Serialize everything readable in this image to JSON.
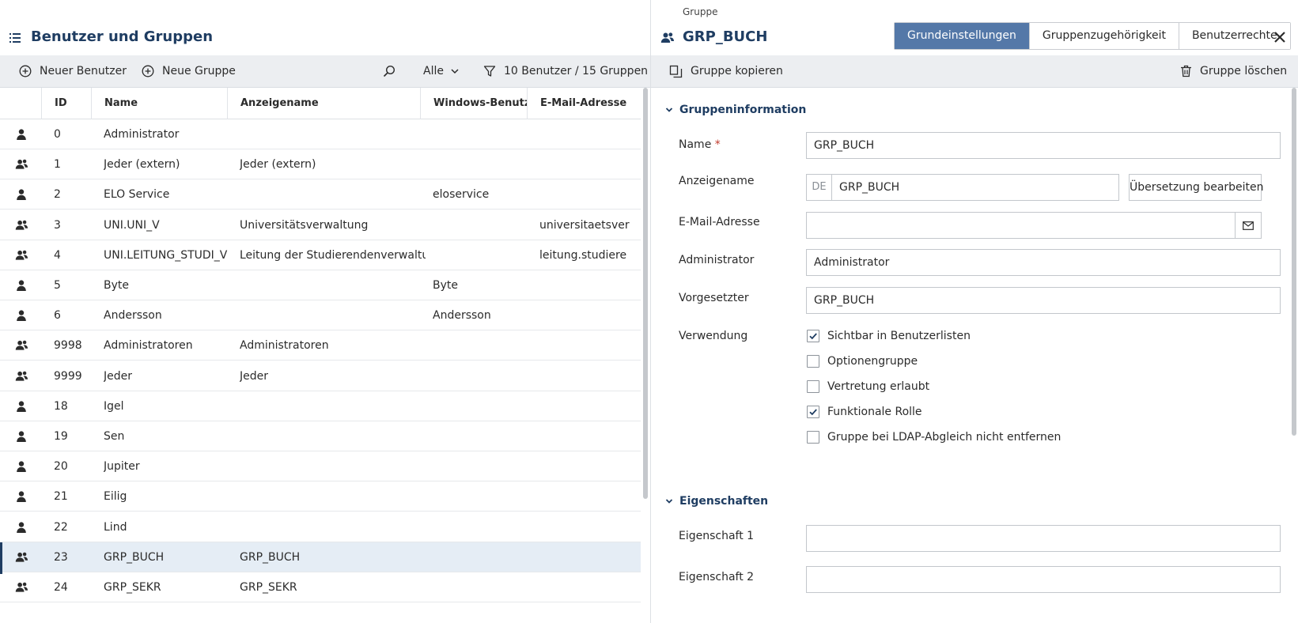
{
  "left": {
    "title": "Benutzer und Gruppen",
    "toolbar": {
      "new_user": "Neuer Benutzer",
      "new_group": "Neue Gruppe",
      "filter_value": "Alle",
      "count": "10 Benutzer / 15 Gruppen"
    },
    "columns": [
      "ID",
      "Name",
      "Anzeigename",
      "Windows-Benutzer",
      "E-Mail-Adresse"
    ],
    "rows": [
      {
        "type": "user",
        "id": "0",
        "name": "Administrator",
        "display": "",
        "windows": "",
        "email": ""
      },
      {
        "type": "group",
        "id": "1",
        "name": "Jeder (extern)",
        "display": "Jeder (extern)",
        "windows": "",
        "email": ""
      },
      {
        "type": "user",
        "id": "2",
        "name": "ELO Service",
        "display": "",
        "windows": "eloservice",
        "email": ""
      },
      {
        "type": "group",
        "id": "3",
        "name": "UNI.UNI_V",
        "display": "Universitätsverwaltung",
        "windows": "",
        "email": "universitaetsver"
      },
      {
        "type": "group",
        "id": "4",
        "name": "UNI.LEITUNG_STUDI_V",
        "display": "Leitung der Studierendenverwaltung",
        "windows": "",
        "email": "leitung.studiere"
      },
      {
        "type": "user",
        "id": "5",
        "name": "Byte",
        "display": "",
        "windows": "Byte",
        "email": ""
      },
      {
        "type": "user",
        "id": "6",
        "name": "Andersson",
        "display": "",
        "windows": "Andersson",
        "email": ""
      },
      {
        "type": "group",
        "id": "9998",
        "name": "Administratoren",
        "display": "Administratoren",
        "windows": "",
        "email": ""
      },
      {
        "type": "group",
        "id": "9999",
        "name": "Jeder",
        "display": "Jeder",
        "windows": "",
        "email": ""
      },
      {
        "type": "user",
        "id": "18",
        "name": "Igel",
        "display": "",
        "windows": "",
        "email": ""
      },
      {
        "type": "user",
        "id": "19",
        "name": "Sen",
        "display": "",
        "windows": "",
        "email": ""
      },
      {
        "type": "user",
        "id": "20",
        "name": "Jupiter",
        "display": "",
        "windows": "",
        "email": ""
      },
      {
        "type": "user",
        "id": "21",
        "name": "Eilig",
        "display": "",
        "windows": "",
        "email": ""
      },
      {
        "type": "user",
        "id": "22",
        "name": "Lind",
        "display": "",
        "windows": "",
        "email": ""
      },
      {
        "type": "group",
        "id": "23",
        "name": "GRP_BUCH",
        "display": "GRP_BUCH",
        "windows": "",
        "email": "",
        "selected": true
      },
      {
        "type": "group",
        "id": "24",
        "name": "GRP_SEKR",
        "display": "GRP_SEKR",
        "windows": "",
        "email": ""
      }
    ]
  },
  "right": {
    "kicker": "Gruppe",
    "title": "GRP_BUCH",
    "tabs": [
      {
        "label": "Grundeinstellungen",
        "active": true
      },
      {
        "label": "Gruppenzugehörigkeit",
        "active": false
      },
      {
        "label": "Benutzerrechte",
        "active": false
      }
    ],
    "toolbar": {
      "copy": "Gruppe kopieren",
      "delete": "Gruppe löschen"
    },
    "section1": "Gruppeninformation",
    "fields": {
      "name_label": "Name",
      "required_mark": "*",
      "name_value": "GRP_BUCH",
      "display_label": "Anzeigename",
      "lang": "DE",
      "display_value": "GRP_BUCH",
      "translate_btn": "Übersetzung bearbeiten",
      "email_label": "E-Mail-Adresse",
      "email_value": "",
      "admin_label": "Administrator",
      "admin_value": "Administrator",
      "supervisor_label": "Vorgesetzter",
      "supervisor_value": "GRP_BUCH",
      "usage_label": "Verwendung"
    },
    "checkboxes": [
      {
        "label": "Sichtbar in Benutzerlisten",
        "checked": true
      },
      {
        "label": "Optionengruppe",
        "checked": false
      },
      {
        "label": "Vertretung erlaubt",
        "checked": false
      },
      {
        "label": "Funktionale Rolle",
        "checked": true
      },
      {
        "label": "Gruppe bei LDAP-Abgleich nicht entfernen",
        "checked": false
      }
    ],
    "section2": "Eigenschaften",
    "properties": [
      {
        "label": "Eigenschaft 1",
        "value": ""
      },
      {
        "label": "Eigenschaft 2",
        "value": ""
      }
    ]
  },
  "colors": {
    "accent": "#1f3d62",
    "tab_active": "#5478a8",
    "checkbox": "#1f3d62",
    "row_selected": "#e5edf5"
  }
}
